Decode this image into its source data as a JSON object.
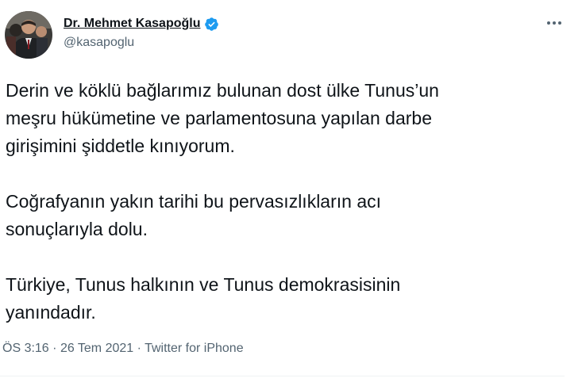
{
  "author": {
    "display_name": "Dr. Mehmet Kasapoğlu",
    "handle": "@kasapoglu",
    "verified": true,
    "verified_color": "#1d9bf0",
    "avatar_icon": "profile-photo"
  },
  "tweet": {
    "paragraphs": [
      "Derin ve köklü bağlarımız bulunan dost ülke Tunus’un\nmeşru hükümetine ve parlamentosuna yapılan darbe\ngirişimini şiddetle kınıyorum.",
      "Coğrafyanın yakın tarihi bu pervasızlıkların acı\nsonuçlarıyla dolu.",
      "Türkiye, Tunus halkının ve Tunus demokrasisinin\nyanındadır."
    ],
    "time": "ÖS 3:16",
    "separator": "·",
    "date": "26 Tem 2021",
    "source": "Twitter for iPhone"
  },
  "menu": {
    "more_icon": "more-horizontal-icon"
  }
}
